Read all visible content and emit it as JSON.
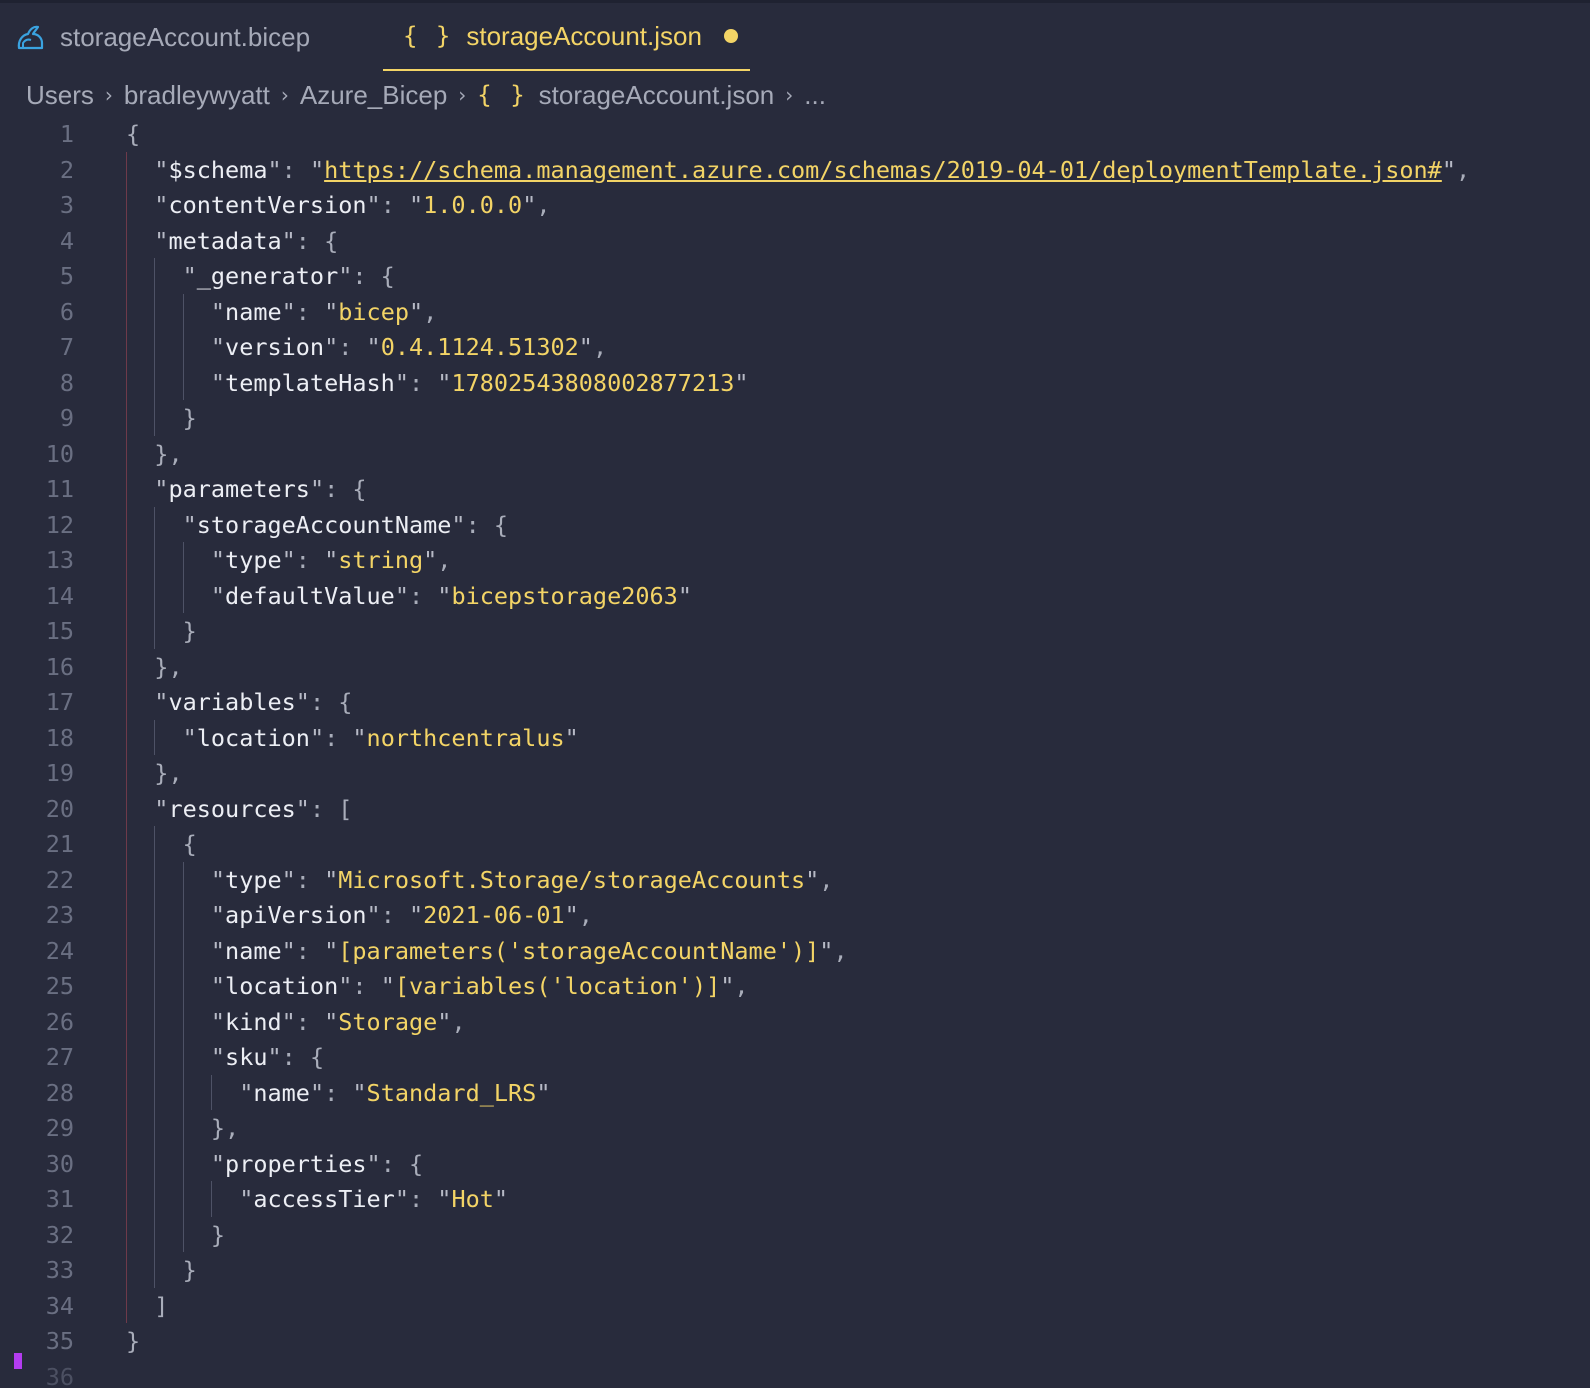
{
  "tabs": [
    {
      "label": "storageAccount.bicep",
      "icon": "bicep-arm-icon",
      "active": false
    },
    {
      "label": "storageAccount.json",
      "icon": "json-braces-icon",
      "active": true,
      "modified": true
    }
  ],
  "breadcrumb": {
    "items": [
      "Users",
      "bradleywyatt",
      "Azure_Bicep",
      "storageAccount.json",
      "..."
    ],
    "json_icon_glyph": "{ }"
  },
  "tab_icon_glyph": "{ }",
  "colors": {
    "background": "#282b3c",
    "accent": "#f3d466",
    "text": "#a6aab8",
    "line_number": "#6a6f82"
  },
  "editor": {
    "lines": [
      [
        {
          "t": "p",
          "v": "{"
        }
      ],
      [
        {
          "t": "q",
          "v": "\""
        },
        {
          "t": "k",
          "v": "$schema"
        },
        {
          "t": "q",
          "v": "\""
        },
        {
          "t": "p",
          "v": ": "
        },
        {
          "t": "q",
          "v": "\""
        },
        {
          "t": "sl",
          "v": "https://schema.management.azure.com/schemas/2019-04-01/deploymentTemplate.json#"
        },
        {
          "t": "q",
          "v": "\""
        },
        {
          "t": "p",
          "v": ","
        }
      ],
      [
        {
          "t": "q",
          "v": "\""
        },
        {
          "t": "k",
          "v": "contentVersion"
        },
        {
          "t": "q",
          "v": "\""
        },
        {
          "t": "p",
          "v": ": "
        },
        {
          "t": "q",
          "v": "\""
        },
        {
          "t": "s",
          "v": "1.0.0.0"
        },
        {
          "t": "q",
          "v": "\""
        },
        {
          "t": "p",
          "v": ","
        }
      ],
      [
        {
          "t": "q",
          "v": "\""
        },
        {
          "t": "k",
          "v": "metadata"
        },
        {
          "t": "q",
          "v": "\""
        },
        {
          "t": "p",
          "v": ": {"
        }
      ],
      [
        {
          "t": "q",
          "v": "\""
        },
        {
          "t": "k",
          "v": "_generator"
        },
        {
          "t": "q",
          "v": "\""
        },
        {
          "t": "p",
          "v": ": {"
        }
      ],
      [
        {
          "t": "q",
          "v": "\""
        },
        {
          "t": "k",
          "v": "name"
        },
        {
          "t": "q",
          "v": "\""
        },
        {
          "t": "p",
          "v": ": "
        },
        {
          "t": "q",
          "v": "\""
        },
        {
          "t": "s",
          "v": "bicep"
        },
        {
          "t": "q",
          "v": "\""
        },
        {
          "t": "p",
          "v": ","
        }
      ],
      [
        {
          "t": "q",
          "v": "\""
        },
        {
          "t": "k",
          "v": "version"
        },
        {
          "t": "q",
          "v": "\""
        },
        {
          "t": "p",
          "v": ": "
        },
        {
          "t": "q",
          "v": "\""
        },
        {
          "t": "s",
          "v": "0.4.1124.51302"
        },
        {
          "t": "q",
          "v": "\""
        },
        {
          "t": "p",
          "v": ","
        }
      ],
      [
        {
          "t": "q",
          "v": "\""
        },
        {
          "t": "k",
          "v": "templateHash"
        },
        {
          "t": "q",
          "v": "\""
        },
        {
          "t": "p",
          "v": ": "
        },
        {
          "t": "q",
          "v": "\""
        },
        {
          "t": "s",
          "v": "17802543808002877213"
        },
        {
          "t": "q",
          "v": "\""
        }
      ],
      [
        {
          "t": "p",
          "v": "}"
        }
      ],
      [
        {
          "t": "p",
          "v": "},"
        }
      ],
      [
        {
          "t": "q",
          "v": "\""
        },
        {
          "t": "k",
          "v": "parameters"
        },
        {
          "t": "q",
          "v": "\""
        },
        {
          "t": "p",
          "v": ": {"
        }
      ],
      [
        {
          "t": "q",
          "v": "\""
        },
        {
          "t": "k",
          "v": "storageAccountName"
        },
        {
          "t": "q",
          "v": "\""
        },
        {
          "t": "p",
          "v": ": {"
        }
      ],
      [
        {
          "t": "q",
          "v": "\""
        },
        {
          "t": "k",
          "v": "type"
        },
        {
          "t": "q",
          "v": "\""
        },
        {
          "t": "p",
          "v": ": "
        },
        {
          "t": "q",
          "v": "\""
        },
        {
          "t": "s",
          "v": "string"
        },
        {
          "t": "q",
          "v": "\""
        },
        {
          "t": "p",
          "v": ","
        }
      ],
      [
        {
          "t": "q",
          "v": "\""
        },
        {
          "t": "k",
          "v": "defaultValue"
        },
        {
          "t": "q",
          "v": "\""
        },
        {
          "t": "p",
          "v": ": "
        },
        {
          "t": "q",
          "v": "\""
        },
        {
          "t": "s",
          "v": "bicepstorage2063"
        },
        {
          "t": "q",
          "v": "\""
        }
      ],
      [
        {
          "t": "p",
          "v": "}"
        }
      ],
      [
        {
          "t": "p",
          "v": "},"
        }
      ],
      [
        {
          "t": "q",
          "v": "\""
        },
        {
          "t": "k",
          "v": "variables"
        },
        {
          "t": "q",
          "v": "\""
        },
        {
          "t": "p",
          "v": ": {"
        }
      ],
      [
        {
          "t": "q",
          "v": "\""
        },
        {
          "t": "k",
          "v": "location"
        },
        {
          "t": "q",
          "v": "\""
        },
        {
          "t": "p",
          "v": ": "
        },
        {
          "t": "q",
          "v": "\""
        },
        {
          "t": "s",
          "v": "northcentralus"
        },
        {
          "t": "q",
          "v": "\""
        }
      ],
      [
        {
          "t": "p",
          "v": "},"
        }
      ],
      [
        {
          "t": "q",
          "v": "\""
        },
        {
          "t": "k",
          "v": "resources"
        },
        {
          "t": "q",
          "v": "\""
        },
        {
          "t": "p",
          "v": ": ["
        }
      ],
      [
        {
          "t": "p",
          "v": "{"
        }
      ],
      [
        {
          "t": "q",
          "v": "\""
        },
        {
          "t": "k",
          "v": "type"
        },
        {
          "t": "q",
          "v": "\""
        },
        {
          "t": "p",
          "v": ": "
        },
        {
          "t": "q",
          "v": "\""
        },
        {
          "t": "s",
          "v": "Microsoft.Storage/storageAccounts"
        },
        {
          "t": "q",
          "v": "\""
        },
        {
          "t": "p",
          "v": ","
        }
      ],
      [
        {
          "t": "q",
          "v": "\""
        },
        {
          "t": "k",
          "v": "apiVersion"
        },
        {
          "t": "q",
          "v": "\""
        },
        {
          "t": "p",
          "v": ": "
        },
        {
          "t": "q",
          "v": "\""
        },
        {
          "t": "s",
          "v": "2021-06-01"
        },
        {
          "t": "q",
          "v": "\""
        },
        {
          "t": "p",
          "v": ","
        }
      ],
      [
        {
          "t": "q",
          "v": "\""
        },
        {
          "t": "k",
          "v": "name"
        },
        {
          "t": "q",
          "v": "\""
        },
        {
          "t": "p",
          "v": ": "
        },
        {
          "t": "q",
          "v": "\""
        },
        {
          "t": "s",
          "v": "[parameters('storageAccountName')]"
        },
        {
          "t": "q",
          "v": "\""
        },
        {
          "t": "p",
          "v": ","
        }
      ],
      [
        {
          "t": "q",
          "v": "\""
        },
        {
          "t": "k",
          "v": "location"
        },
        {
          "t": "q",
          "v": "\""
        },
        {
          "t": "p",
          "v": ": "
        },
        {
          "t": "q",
          "v": "\""
        },
        {
          "t": "s",
          "v": "[variables('location')]"
        },
        {
          "t": "q",
          "v": "\""
        },
        {
          "t": "p",
          "v": ","
        }
      ],
      [
        {
          "t": "q",
          "v": "\""
        },
        {
          "t": "k",
          "v": "kind"
        },
        {
          "t": "q",
          "v": "\""
        },
        {
          "t": "p",
          "v": ": "
        },
        {
          "t": "q",
          "v": "\""
        },
        {
          "t": "s",
          "v": "Storage"
        },
        {
          "t": "q",
          "v": "\""
        },
        {
          "t": "p",
          "v": ","
        }
      ],
      [
        {
          "t": "q",
          "v": "\""
        },
        {
          "t": "k",
          "v": "sku"
        },
        {
          "t": "q",
          "v": "\""
        },
        {
          "t": "p",
          "v": ": {"
        }
      ],
      [
        {
          "t": "q",
          "v": "\""
        },
        {
          "t": "k",
          "v": "name"
        },
        {
          "t": "q",
          "v": "\""
        },
        {
          "t": "p",
          "v": ": "
        },
        {
          "t": "q",
          "v": "\""
        },
        {
          "t": "s",
          "v": "Standard_LRS"
        },
        {
          "t": "q",
          "v": "\""
        }
      ],
      [
        {
          "t": "p",
          "v": "},"
        }
      ],
      [
        {
          "t": "q",
          "v": "\""
        },
        {
          "t": "k",
          "v": "properties"
        },
        {
          "t": "q",
          "v": "\""
        },
        {
          "t": "p",
          "v": ": {"
        }
      ],
      [
        {
          "t": "q",
          "v": "\""
        },
        {
          "t": "k",
          "v": "accessTier"
        },
        {
          "t": "q",
          "v": "\""
        },
        {
          "t": "p",
          "v": ": "
        },
        {
          "t": "q",
          "v": "\""
        },
        {
          "t": "s",
          "v": "Hot"
        },
        {
          "t": "q",
          "v": "\""
        }
      ],
      [
        {
          "t": "p",
          "v": "}"
        }
      ],
      [
        {
          "t": "p",
          "v": "}"
        }
      ],
      [
        {
          "t": "p",
          "v": "]"
        }
      ],
      [
        {
          "t": "p",
          "v": "}"
        }
      ],
      []
    ],
    "line_numbers": [
      "1",
      "2",
      "3",
      "4",
      "5",
      "6",
      "7",
      "8",
      "9",
      "10",
      "11",
      "12",
      "13",
      "14",
      "15",
      "16",
      "17",
      "18",
      "19",
      "20",
      "21",
      "22",
      "23",
      "24",
      "25",
      "26",
      "27",
      "28",
      "29",
      "30",
      "31",
      "32",
      "33",
      "34",
      "35",
      "36"
    ]
  }
}
